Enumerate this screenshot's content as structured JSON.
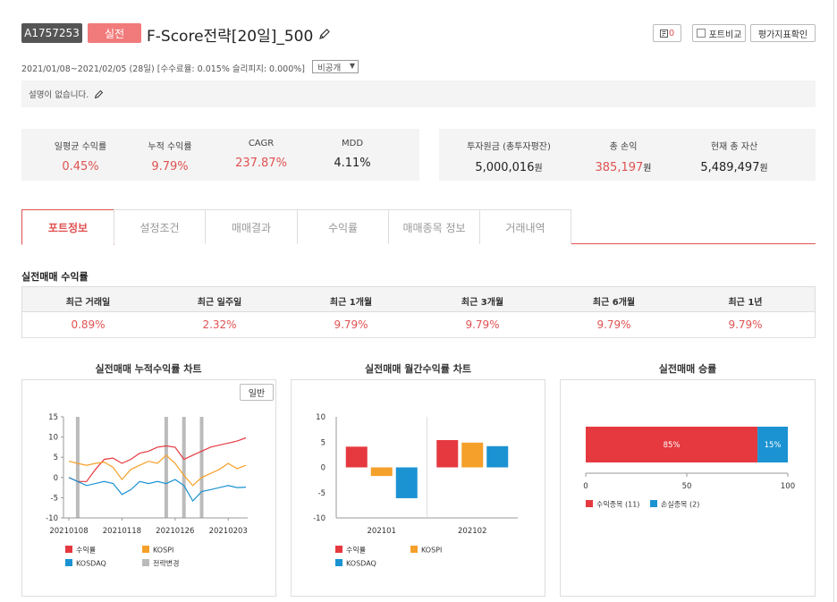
{
  "header": {
    "id_badge": "A1757253",
    "mode_badge": "실전",
    "title": "F-Score전략[20일]_500",
    "counter": "0",
    "compare_label": "포트비교",
    "metrics_label": "평가지표확인"
  },
  "meta": {
    "period": "2021/01/08~2021/02/05 (28일) [수수료율: 0.015% 슬리피지: 0.000%]",
    "visibility": "비공개",
    "description": "설명이 없습니다."
  },
  "summary": [
    {
      "label": "일평균 수익률",
      "value": "0.45%"
    },
    {
      "label": "누적 수익률",
      "value": "9.79%"
    },
    {
      "label": "CAGR",
      "value": "237.87%"
    },
    {
      "label": "MDD",
      "value": "4.11%"
    }
  ],
  "assets": [
    {
      "label": "투자원금 (총투자평잔)",
      "value": "5,000,016",
      "unit": "원"
    },
    {
      "label": "총 손익",
      "value": "385,197",
      "unit": "원"
    },
    {
      "label": "현재 총 자산",
      "value": "5,489,497",
      "unit": "원"
    }
  ],
  "tabs": [
    "포트정보",
    "설정조건",
    "매매결과",
    "수익률",
    "매매종목 정보",
    "거래내역"
  ],
  "returns_section": {
    "title": "실전매매 수익률",
    "headers": [
      "최근 거래일",
      "최근 일주일",
      "최근 1개월",
      "최근 3개월",
      "최근 6개월",
      "최근 1년"
    ],
    "values": [
      "0.89%",
      "2.32%",
      "9.79%",
      "9.79%",
      "9.79%",
      "9.79%"
    ]
  },
  "charts": {
    "cumulative_title": "실전매매 누적수익률 차트",
    "scale_button": "일반",
    "monthly_title": "실전매매 월간수익률 차트",
    "winrate_title": "실전매매 승률"
  },
  "colors": {
    "red": "#e5393f",
    "orange": "#f5a02a",
    "blue": "#1b92d2",
    "gray": "#bbbbbb",
    "accent": "#e05252"
  },
  "chart_data": [
    {
      "type": "line",
      "title": "실전매매 누적수익률 차트",
      "x": [
        "20210108",
        "20210111",
        "20210112",
        "20210113",
        "20210114",
        "20210115",
        "20210118",
        "20210119",
        "20210120",
        "20210121",
        "20210122",
        "20210125",
        "20210126",
        "20210127",
        "20210128",
        "20210129",
        "20210201",
        "20210202",
        "20210203",
        "20210204",
        "20210205"
      ],
      "x_tick_labels": [
        "20210108",
        "20210118",
        "20210126",
        "20210203"
      ],
      "ylim": [
        -10,
        15
      ],
      "y_ticks": [
        15,
        10,
        5,
        0,
        -5,
        -10
      ],
      "strategy_change_dates": [
        "20210111",
        "20210125",
        "20210127",
        "20210129"
      ],
      "series": [
        {
          "name": "수익률",
          "color": "#e5393f",
          "values": [
            0,
            -1,
            -1,
            2,
            4.5,
            4.8,
            3.5,
            4.5,
            6,
            6.5,
            7.5,
            7.8,
            7.5,
            4.5,
            5.5,
            6.5,
            7.5,
            8,
            8.5,
            9,
            9.8
          ]
        },
        {
          "name": "KOSPI",
          "color": "#f5a02a",
          "values": [
            4,
            3.5,
            3,
            3.5,
            3.8,
            2.5,
            -0.5,
            2,
            3,
            4,
            3.5,
            5.5,
            3.5,
            0.5,
            -2,
            0,
            1,
            2,
            3.5,
            2.2,
            3
          ]
        },
        {
          "name": "KOSDAQ",
          "color": "#1b92d2",
          "values": [
            0,
            -1,
            -2,
            -1.5,
            -1,
            -1.5,
            -4.2,
            -3,
            -1,
            -1.5,
            -1,
            -1.5,
            -0.5,
            -2,
            -5.8,
            -3.5,
            -3,
            -2.5,
            -2,
            -2.5,
            -2.4
          ]
        },
        {
          "name": "전략변경",
          "color": "#bbbbbb",
          "values": []
        }
      ]
    },
    {
      "type": "bar",
      "title": "실전매매 월간수익률 차트",
      "categories": [
        "202101",
        "202102"
      ],
      "ylim": [
        -10,
        10
      ],
      "y_ticks": [
        10,
        5,
        0,
        -5,
        -10
      ],
      "series": [
        {
          "name": "수익률",
          "color": "#e5393f",
          "values": [
            4.1,
            5.4
          ]
        },
        {
          "name": "KOSPI",
          "color": "#f5a02a",
          "values": [
            -1.7,
            4.9
          ]
        },
        {
          "name": "KOSDAQ",
          "color": "#1b92d2",
          "values": [
            -6.1,
            4.2
          ]
        }
      ]
    },
    {
      "type": "bar",
      "title": "실전매매 승률",
      "orientation": "horizontal-stacked",
      "xlim": [
        0,
        100
      ],
      "x_ticks": [
        0,
        50,
        100
      ],
      "series": [
        {
          "name": "수익종목",
          "count": "(11)",
          "color": "#e5393f",
          "value": 85,
          "label": "85%"
        },
        {
          "name": "손실종목",
          "count": "(2)",
          "color": "#1b92d2",
          "value": 15,
          "label": "15%"
        }
      ]
    }
  ]
}
